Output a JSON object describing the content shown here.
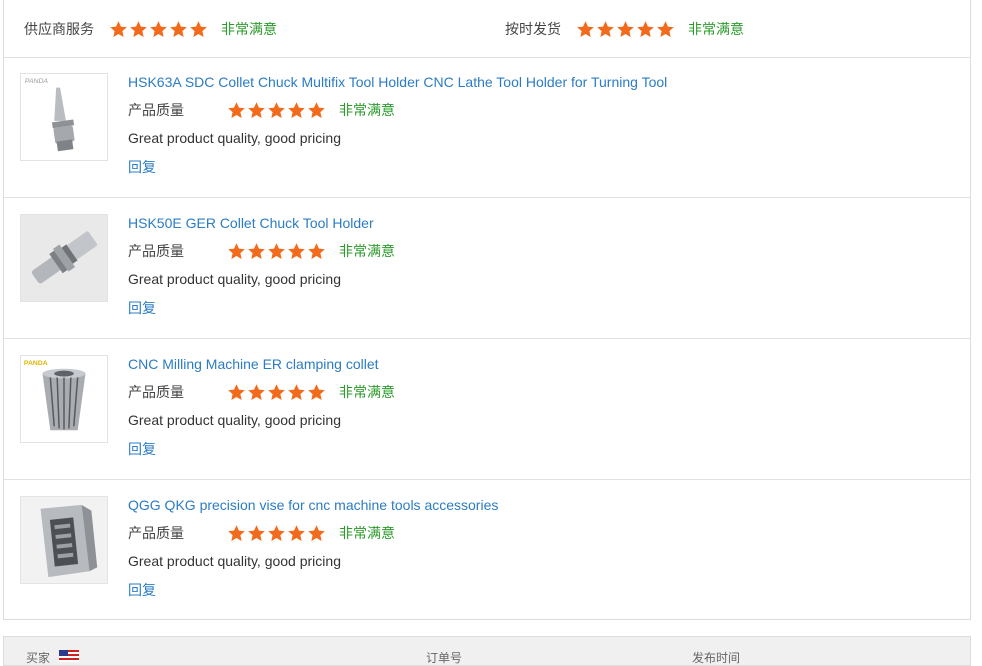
{
  "summary": {
    "supplier_service_label": "供应商服务",
    "supplier_service_rating": 5,
    "supplier_service_text": "非常满意",
    "delivery_label": "按时发货",
    "delivery_rating": 5,
    "delivery_text": "非常满意"
  },
  "reviews": [
    {
      "title": "HSK63A SDC Collet Chuck Multifix Tool Holder CNC Lathe Tool Holder for Turning Tool",
      "quality_label": "产品质量",
      "rating": 5,
      "satisfaction": "非常满意",
      "comment": "Great product quality, good pricing",
      "reply": "回复",
      "thumb_icon": "tool-holder-image",
      "thumb_brand": "PANDA"
    },
    {
      "title": "HSK50E GER Collet Chuck Tool Holder",
      "quality_label": "产品质量",
      "rating": 5,
      "satisfaction": "非常满意",
      "comment": "Great product quality, good pricing",
      "reply": "回复",
      "thumb_icon": "collet-chuck-image"
    },
    {
      "title": "CNC Milling Machine ER clamping collet",
      "quality_label": "产品质量",
      "rating": 5,
      "satisfaction": "非常满意",
      "comment": "Great product quality, good pricing",
      "reply": "回复",
      "thumb_icon": "er-collet-image",
      "thumb_brand": "PANDA"
    },
    {
      "title": "QGG QKG precision vise for cnc machine tools accessories",
      "quality_label": "产品质量",
      "rating": 5,
      "satisfaction": "非常满意",
      "comment": "Great product quality, good pricing",
      "reply": "回复",
      "thumb_icon": "precision-vise-image"
    }
  ],
  "footer": {
    "buyer_label": "买家",
    "order_label": "订单号",
    "time_label": "发布时间"
  },
  "colors": {
    "star": "#f26b1d",
    "link": "#2b7cc4",
    "satisfied": "#2a9a2a"
  }
}
